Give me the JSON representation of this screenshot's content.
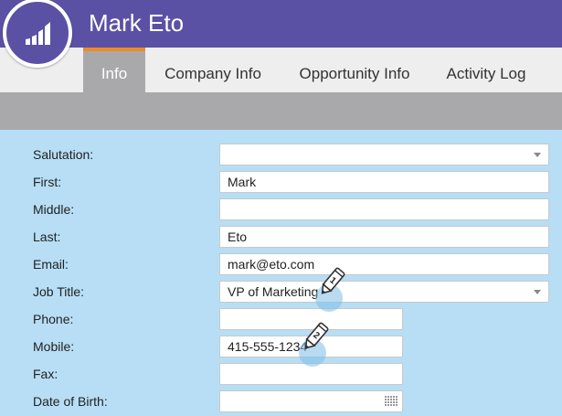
{
  "header": {
    "title": "Mark Eto"
  },
  "tabs": [
    {
      "label": "Info",
      "active": true
    },
    {
      "label": "Company Info",
      "active": false
    },
    {
      "label": "Opportunity Info",
      "active": false
    },
    {
      "label": "Activity Log",
      "active": false
    }
  ],
  "form": {
    "fields": [
      {
        "label": "Salutation:",
        "value": "",
        "type": "select"
      },
      {
        "label": "First:",
        "value": "Mark",
        "type": "text"
      },
      {
        "label": "Middle:",
        "value": "",
        "type": "text"
      },
      {
        "label": "Last:",
        "value": "Eto",
        "type": "text"
      },
      {
        "label": "Email:",
        "value": "mark@eto.com",
        "type": "text"
      },
      {
        "label": "Job Title:",
        "value": "VP of Marketing",
        "type": "select"
      },
      {
        "label": "Phone:",
        "value": "",
        "type": "text"
      },
      {
        "label": "Mobile:",
        "value": "415-555-1234",
        "type": "text"
      },
      {
        "label": "Fax:",
        "value": "",
        "type": "text"
      },
      {
        "label": "Date of Birth:",
        "value": "",
        "type": "date"
      }
    ]
  },
  "markers": [
    {
      "number": "1"
    },
    {
      "number": "2"
    }
  ],
  "colors": {
    "header": "#5a51a5",
    "tab_accent": "#f08a24",
    "form_bg": "#b7def5",
    "tab_bar": "#eeeeef",
    "subbar": "#a9a9ac"
  },
  "icons": {
    "logo": "bar-chart-logo-icon",
    "dropdown": "chevron-down-icon",
    "calendar": "calendar-icon",
    "marker": "pencil-marker-icon"
  }
}
